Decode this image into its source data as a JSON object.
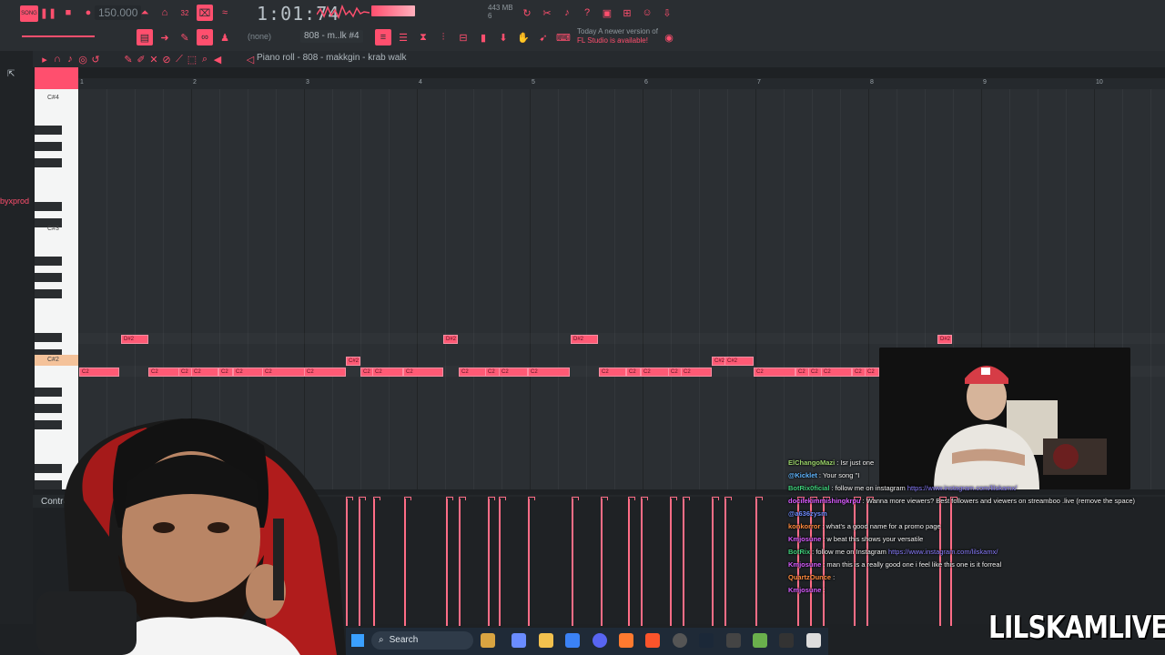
{
  "toolbar": {
    "song_badge": "SONG",
    "tempo": "150.000",
    "time": "1:01:74",
    "memory_top": "443 MB",
    "memory_bottom": "6",
    "pattern": "808 - m..lk #4",
    "none_label": "(none)",
    "update_notice_a": "Today",
    "update_notice_b": "A newer version of",
    "update_notice_c": "FL Studio is available!",
    "accent": "#ff4f6e"
  },
  "piano_roll": {
    "title": "Piano roll - 808 - makkgin - krab walk",
    "ruler": [
      "1",
      "2",
      "3",
      "4",
      "5",
      "6",
      "7",
      "8",
      "9",
      "10"
    ],
    "octave_labels": [
      "C#4",
      "C#3",
      "C#2"
    ],
    "note_c2": "C2",
    "note_d2": "D#2",
    "note_c2s": "C#2"
  },
  "dock": {
    "name": "byxprod"
  },
  "control": {
    "label": "Control"
  },
  "chat": [
    {
      "user": "ElChangoMazi",
      "user_color": "#9ad36a",
      "text": ": Isr just one",
      "link": ""
    },
    {
      "user": "@Kicklet",
      "user_color": "#5fb6ff",
      "text": ": Your song \"I",
      "link": ""
    },
    {
      "user": "BotRix0ficial",
      "user_color": "#3ecf7a",
      "text": ": follow me on instagram ",
      "link": "https://www.instagram.com/lilskamx/"
    },
    {
      "user": "docilekimmishingkrpu",
      "user_color": "#d85cff",
      "text": ": Wanna more viewers? Best followers and viewers on streamboo .live (remove the space)",
      "link": ""
    },
    {
      "user": "@a636zysm",
      "user_color": "#6e8cff",
      "text": "",
      "link": ""
    },
    {
      "user": "konkorror",
      "user_color": "#ff8a3d",
      "text": ": what's a good name for a promo page",
      "link": ""
    },
    {
      "user": "Kmjosune",
      "user_color": "#d85cff",
      "text": ": w beat this shows your versatile",
      "link": ""
    },
    {
      "user": "BotRix",
      "user_color": "#3ecf7a",
      "text": ": follow me on Instagram ",
      "link": "https://www.instagram.com/lilskamx/"
    },
    {
      "user": "Kmjosune",
      "user_color": "#d85cff",
      "text": ": man this is a really good one i feel like this one is it forreal",
      "link": ""
    },
    {
      "user": "QuartzOunce",
      "user_color": "#ff8a3d",
      "text": ":",
      "link": ""
    },
    {
      "user": "Kmjosune",
      "user_color": "#d85cff",
      "text": ":",
      "link": ""
    }
  ],
  "taskbar": {
    "search": "Search"
  },
  "watermark": "LILSKAMLIVE"
}
